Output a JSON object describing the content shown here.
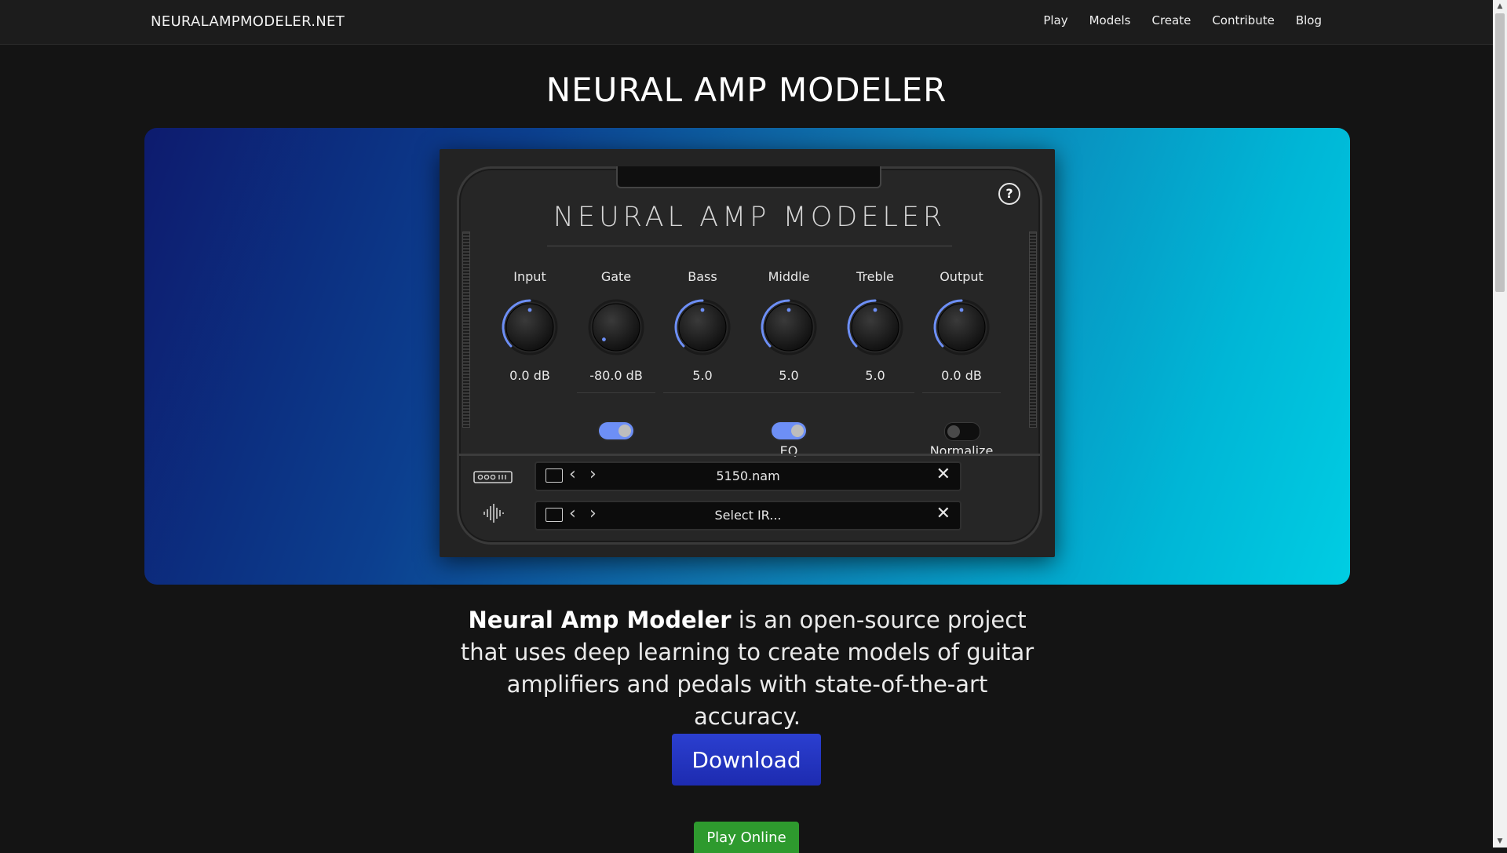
{
  "site": {
    "brand": "NEURALAMPMODELER.NET"
  },
  "nav": {
    "items": [
      "Play",
      "Models",
      "Create",
      "Contribute",
      "Blog"
    ]
  },
  "page": {
    "title": "NEURAL AMP MODELER"
  },
  "plugin": {
    "title": "NEURAL AMP MODELER",
    "help_icon": "?",
    "knobs": [
      {
        "label": "Input",
        "value": "0.0 dB",
        "level": 0.5
      },
      {
        "label": "Gate",
        "value": "-80.0 dB",
        "level": 0.0
      },
      {
        "label": "Bass",
        "value": "5.0",
        "level": 0.5
      },
      {
        "label": "Middle",
        "value": "5.0",
        "level": 0.5
      },
      {
        "label": "Treble",
        "value": "5.0",
        "level": 0.5
      },
      {
        "label": "Output",
        "value": "0.0 dB",
        "level": 0.5
      }
    ],
    "toggles": [
      {
        "name": "gate",
        "label": "",
        "on": true
      },
      {
        "name": "eq",
        "label": "EQ",
        "on": true
      },
      {
        "name": "normalize",
        "label": "Normalize",
        "on": false
      }
    ],
    "model_file": {
      "name": "5150.nam",
      "icon": "amp-icon"
    },
    "ir_file": {
      "name": "Select IR...",
      "icon": "waveform-icon"
    },
    "accent": "#6d8ff6"
  },
  "description": {
    "strong": "Neural Amp Modeler",
    "rest": " is an open-source project that uses deep learning to create models of guitar amplifiers and pedals with state-of-the-art accuracy."
  },
  "buttons": {
    "download": "Download",
    "play_online": "Play Online"
  }
}
